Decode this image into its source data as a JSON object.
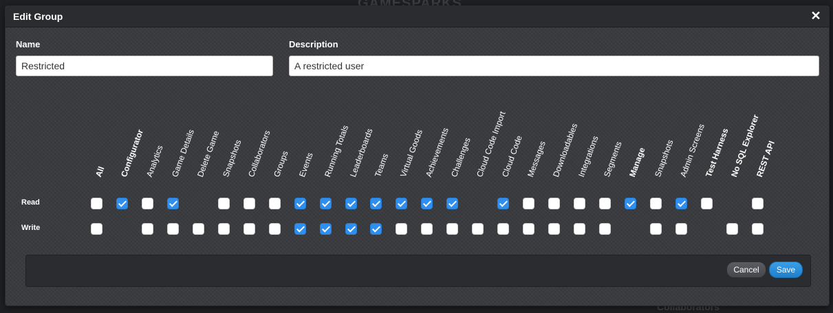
{
  "background": {
    "brand_text": "GAMESPARKS",
    "bottom_text": "Collaborators"
  },
  "dialog": {
    "title": "Edit Group",
    "close_icon": "close-icon"
  },
  "form": {
    "name_label": "Name",
    "name_value": "Restricted",
    "description_label": "Description",
    "description_value": "A restricted user"
  },
  "permissions": {
    "row_labels": {
      "read": "Read",
      "write": "Write"
    },
    "columns": [
      {
        "label": "All",
        "bold": true,
        "read": false,
        "write": false
      },
      {
        "label": "Configurator",
        "bold": true,
        "read": true,
        "write": null
      },
      {
        "label": "Analytics",
        "bold": false,
        "read": false,
        "write": false
      },
      {
        "label": "Game Details",
        "bold": false,
        "read": true,
        "write": false
      },
      {
        "label": "Delete Game",
        "bold": false,
        "read": null,
        "write": false
      },
      {
        "label": "Snapshots",
        "bold": false,
        "read": false,
        "write": false
      },
      {
        "label": "Collaborators",
        "bold": false,
        "read": false,
        "write": false
      },
      {
        "label": "Groups",
        "bold": false,
        "read": false,
        "write": false
      },
      {
        "label": "Events",
        "bold": false,
        "read": true,
        "write": true
      },
      {
        "label": "Running Totals",
        "bold": false,
        "read": true,
        "write": true
      },
      {
        "label": "Leaderboards",
        "bold": false,
        "read": true,
        "write": true
      },
      {
        "label": "Teams",
        "bold": false,
        "read": true,
        "write": true
      },
      {
        "label": "Virtual Goods",
        "bold": false,
        "read": true,
        "write": false
      },
      {
        "label": "Achievements",
        "bold": false,
        "read": true,
        "write": false
      },
      {
        "label": "Challenges",
        "bold": false,
        "read": true,
        "write": false
      },
      {
        "label": "Cloud Code Import",
        "bold": false,
        "read": null,
        "write": false
      },
      {
        "label": "Cloud Code",
        "bold": false,
        "read": true,
        "write": false
      },
      {
        "label": "Messages",
        "bold": false,
        "read": false,
        "write": false
      },
      {
        "label": "Downloadables",
        "bold": false,
        "read": false,
        "write": false
      },
      {
        "label": "Integrations",
        "bold": false,
        "read": false,
        "write": false
      },
      {
        "label": "Segments",
        "bold": false,
        "read": false,
        "write": false
      },
      {
        "label": "Manage",
        "bold": true,
        "read": true,
        "write": null
      },
      {
        "label": "Snapshots",
        "bold": false,
        "read": false,
        "write": false
      },
      {
        "label": "Admin Screens",
        "bold": false,
        "read": true,
        "write": false
      },
      {
        "label": "Test Harness",
        "bold": true,
        "read": false,
        "write": null
      },
      {
        "label": "No SQL Explorer",
        "bold": true,
        "read": null,
        "write": false
      },
      {
        "label": "REST API",
        "bold": true,
        "read": false,
        "write": false
      }
    ]
  },
  "footer": {
    "cancel_label": "Cancel",
    "save_label": "Save"
  },
  "colors": {
    "checked": "#2f8ff0",
    "save_button": "#2a8fdc"
  }
}
